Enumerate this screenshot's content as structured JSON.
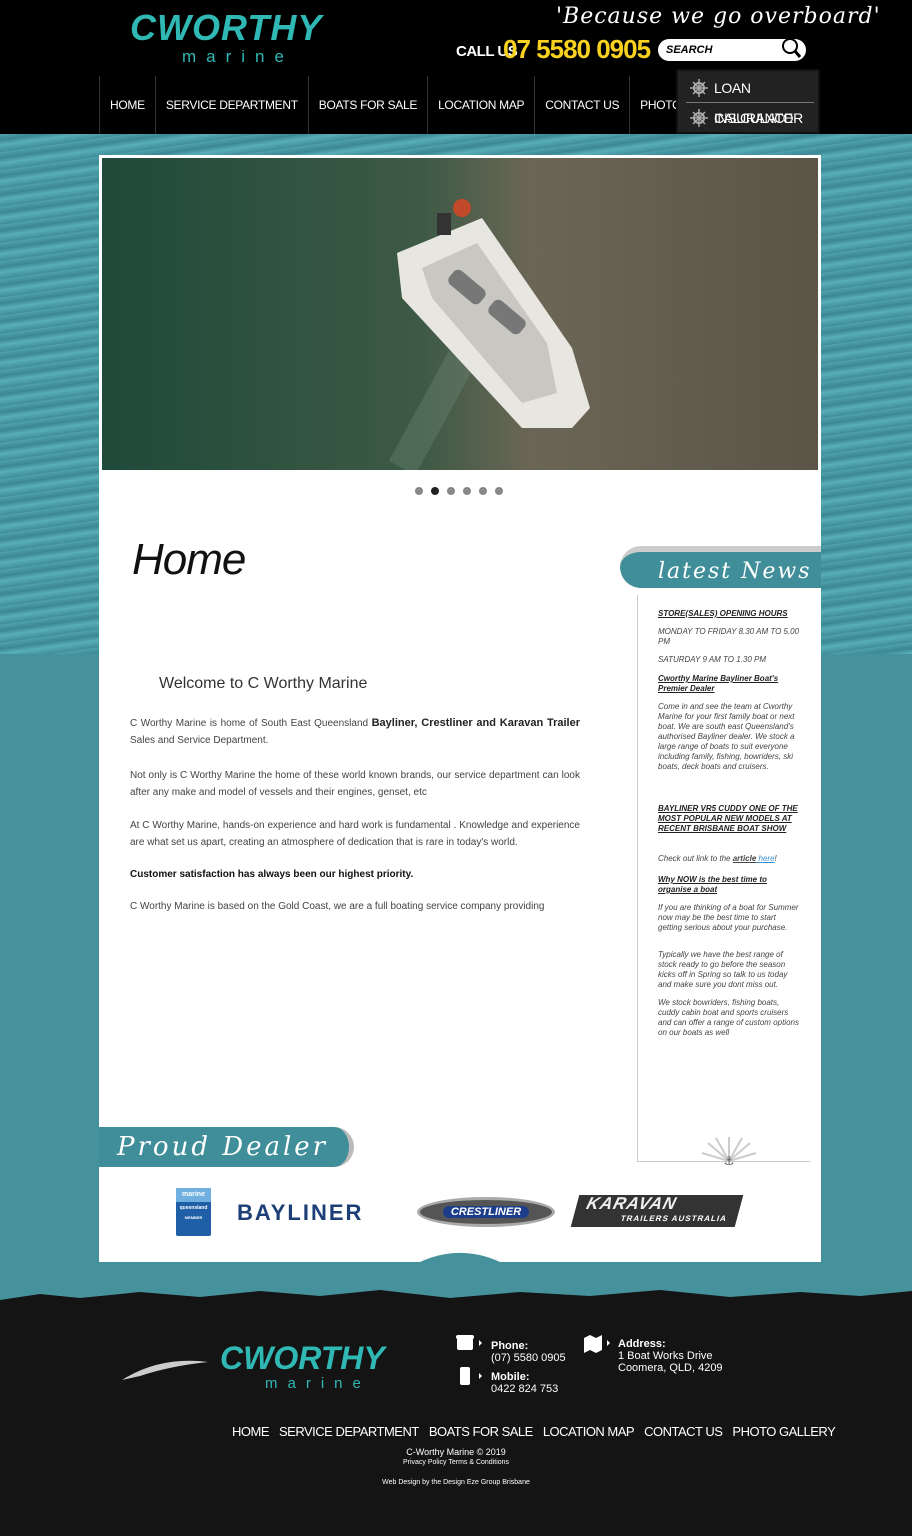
{
  "header": {
    "logo_main": "CWORTHY",
    "logo_sub": "marine",
    "tagline": "'Because we go overboard'",
    "call_label": "CALL US",
    "phone": "07 5580 0905",
    "search_placeholder": "SEARCH",
    "accent": "#f8d21f",
    "brand_color": "#30b8b5"
  },
  "nav": [
    "HOME",
    "SERVICE DEPARTMENT",
    "BOATS FOR SALE",
    "LOCATION MAP",
    "CONTACT US",
    "PHOTO GALLERY"
  ],
  "side_buttons": {
    "loan": "LOAN CALCULATOR",
    "insurance": "INSURANCE QUOTE"
  },
  "slider": {
    "dots": 6,
    "active_index": 1,
    "hero_icon": "boat-photo"
  },
  "content": {
    "title": "Home",
    "welcome": "Welcome to C Worthy Marine",
    "p1_start": "C Worthy Marine is home of South East Queensland ",
    "p1_brands": "Bayliner, Crestliner and Karavan Trailer",
    "p1_end": " Sales and Service Department.",
    "p2": "Not only is C Worthy Marine the home of these world known brands, our service department can look after any make and model of vessels and their engines, genset, etc",
    "p3": "At C Worthy Marine, hands-on experience and hard work is fundamental . Knowledge and experience are what set us apart, creating an atmosphere of dedication that is rare in today's world.",
    "p4": "Customer satisfaction has always been our highest priority.",
    "p5": "C Worthy Marine is based on the Gold Coast, we are a full boating service company providing"
  },
  "news": {
    "heading": "latest News",
    "items": [
      "STORE(SALES) OPENING HOURS",
      "MONDAY TO FRIDAY 8.30 AM TO 5.00 PM",
      "SATURDAY 9 AM TO 1.30 PM",
      "Cworthy Marine Bayliner Boat's Premier Dealer",
      "Come in and see the team at Cworthy Marine for your first family boat or next boat.  We are south east Queensland's authorised Bayliner dealer. We stock a large range of boats to suit everyone including family, fishing, bowriders, ski boats, deck boats and cruisers.",
      "BAYLINER VR5 CUDDY ONE OF THE MOST POPULAR NEW MODELS AT RECENT BRISBANE BOAT SHOW",
      "Check out link to the ",
      "article",
      " here",
      "!",
      "Why NOW is the best time to organise a boat",
      "If you are thinking of a boat for Summer now may be the best time to start getting serious about your purchase.",
      "Typically we have the best range of stock ready to go before the season kicks off in Spring so talk to us today and make sure you dont miss out.",
      "We stock bowriders, fishing boats, cuddy cabin boat and sports cruisers and can offer a range of custom options on our boats as well"
    ]
  },
  "dealers": {
    "heading": "Proud Dealer of",
    "mq_top": "marine",
    "mq_mid": "queensland",
    "mq_bottom": "MEMBER",
    "bayliner": "BAYLINER",
    "crestliner": "CRESTLINER",
    "karavan": "KARAVAN",
    "karavan_sub": "TRAILERS AUSTRALIA"
  },
  "footer": {
    "logo_main": "CWORTHY",
    "logo_sub": "marine",
    "phone_label": "Phone:",
    "phone": "(07) 5580 0905",
    "mobile_label": "Mobile:",
    "mobile": "0422 824 753",
    "address_label": "Address:",
    "address1": "1 Boat Works Drive",
    "address2": "Coomera, QLD, 4209",
    "nav": [
      "HOME",
      "SERVICE DEPARTMENT",
      "BOATS FOR SALE",
      "LOCATION MAP",
      "CONTACT US",
      "PHOTO GALLERY"
    ],
    "copyright": "C-Worthy Marine © 2019",
    "privacy": "Privacy Policy",
    "terms": "Terms & Conditions",
    "credit": "Web Design by the Design Eze Group Brisbane"
  }
}
